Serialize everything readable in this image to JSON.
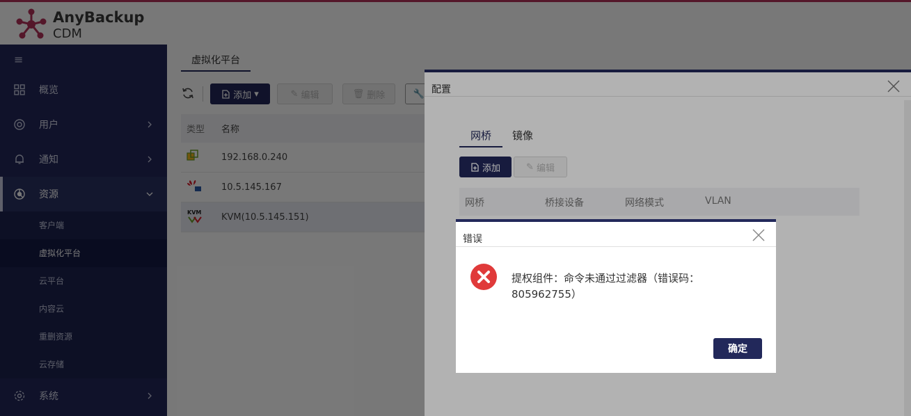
{
  "header": {
    "brand_line1": "AnyBackup",
    "brand_line2": "CDM"
  },
  "sidebar": {
    "items": [
      {
        "label": "概览",
        "icon": "grid-icon"
      },
      {
        "label": "用户",
        "icon": "user-circle-icon"
      },
      {
        "label": "通知",
        "icon": "bell-icon"
      },
      {
        "label": "资源",
        "icon": "pie-chart-icon"
      }
    ],
    "sub_items": [
      "客户端",
      "虚拟化平台",
      "云平台",
      "内容云",
      "重删资源",
      "云存储"
    ],
    "bottom_item": {
      "label": "系统",
      "icon": "gear-icon"
    }
  },
  "main": {
    "tab": "虚拟化平台",
    "toolbar": {
      "add": "添加",
      "edit": "编辑",
      "delete": "删除"
    },
    "columns": [
      "类型",
      "名称"
    ],
    "rows": [
      {
        "name": "192.168.0.240",
        "icon": "vmware-icon"
      },
      {
        "name": "10.5.145.167",
        "icon": "huawei-icon"
      },
      {
        "name": "KVM(10.5.145.151)",
        "icon": "kvm-icon"
      }
    ]
  },
  "config_modal": {
    "title": "配置",
    "tabs": [
      "网桥",
      "镜像"
    ],
    "add_label": "添加",
    "edit_label": "编辑",
    "columns": [
      "网桥",
      "桥接设备",
      "网络模式",
      "VLAN"
    ]
  },
  "error_dialog": {
    "title": "错误",
    "message": "提权组件：命令未通过过滤器（错误码：805962755）",
    "ok_label": "确定"
  },
  "colors": {
    "primary": "#22285a",
    "accent": "#b3315a",
    "error": "#e03a3a"
  }
}
